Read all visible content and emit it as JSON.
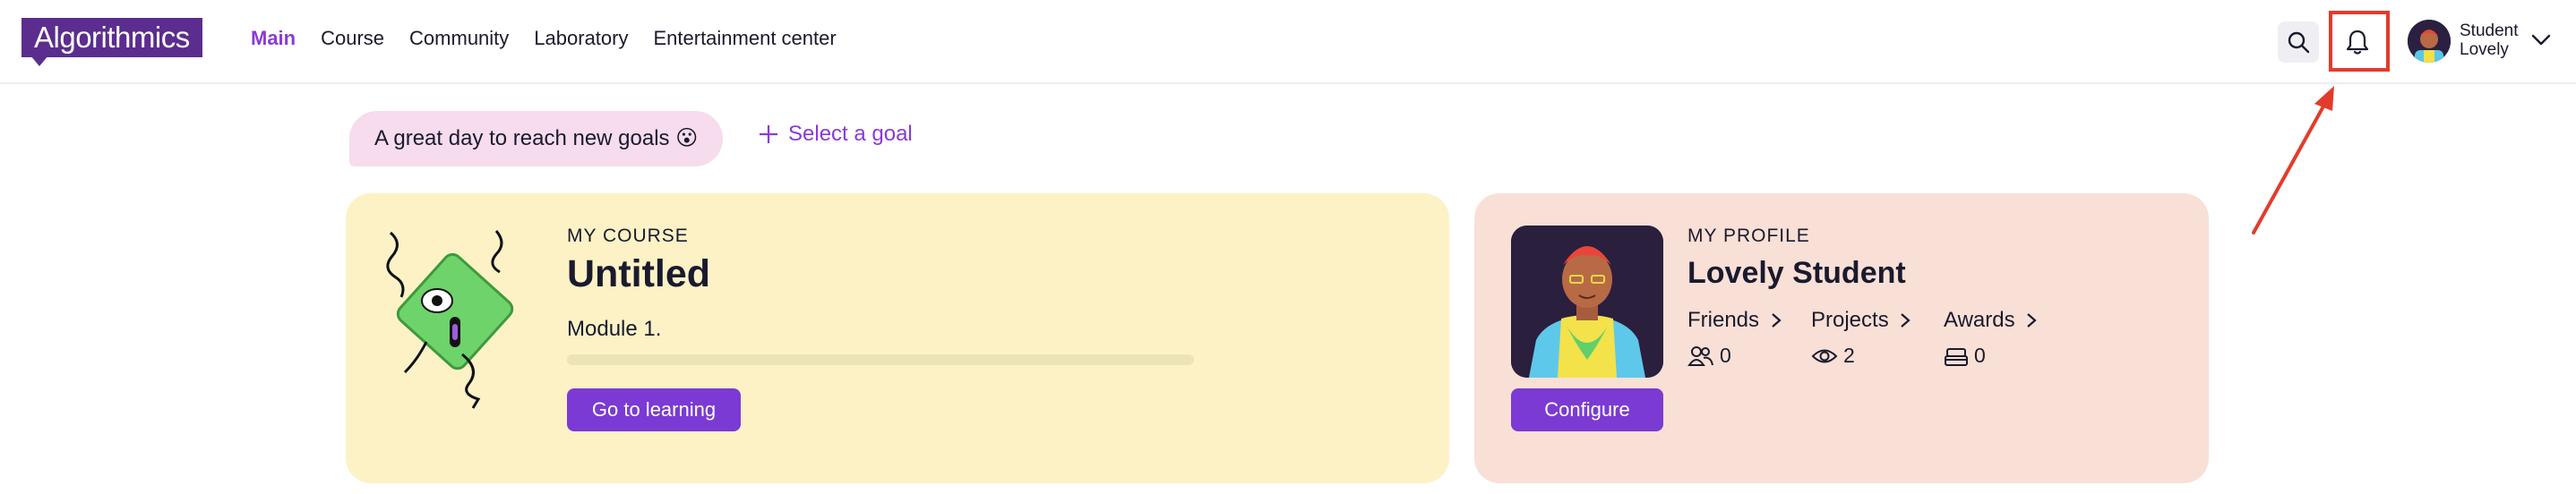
{
  "header": {
    "logo": "Algorithmics",
    "nav": [
      {
        "label": "Main",
        "active": true
      },
      {
        "label": "Course",
        "active": false
      },
      {
        "label": "Community",
        "active": false
      },
      {
        "label": "Laboratory",
        "active": false
      },
      {
        "label": "Entertainment center",
        "active": false
      }
    ],
    "user": {
      "first_line": "Student",
      "second_line": "Lovely"
    }
  },
  "goal": {
    "message": "A great day to reach new goals 😮",
    "select_label": "Select a goal"
  },
  "course_card": {
    "eyebrow": "MY COURSE",
    "title": "Untitled",
    "module": "Module 1.",
    "progress": 0,
    "button": "Go to learning"
  },
  "profile_card": {
    "eyebrow": "MY PROFILE",
    "name": "Lovely Student",
    "button": "Configure",
    "stats": [
      {
        "label": "Friends",
        "value": "0",
        "icon": "friends-icon"
      },
      {
        "label": "Projects",
        "value": "2",
        "icon": "eye-icon"
      },
      {
        "label": "Awards",
        "value": "0",
        "icon": "awards-icon"
      }
    ]
  },
  "colors": {
    "brand": "#5b2d8e",
    "accent": "#8a3ad6",
    "button": "#7b3ad3",
    "course_bg": "#fcf2c6",
    "profile_bg": "#f9e0d6",
    "highlight": "#e33b2b"
  }
}
